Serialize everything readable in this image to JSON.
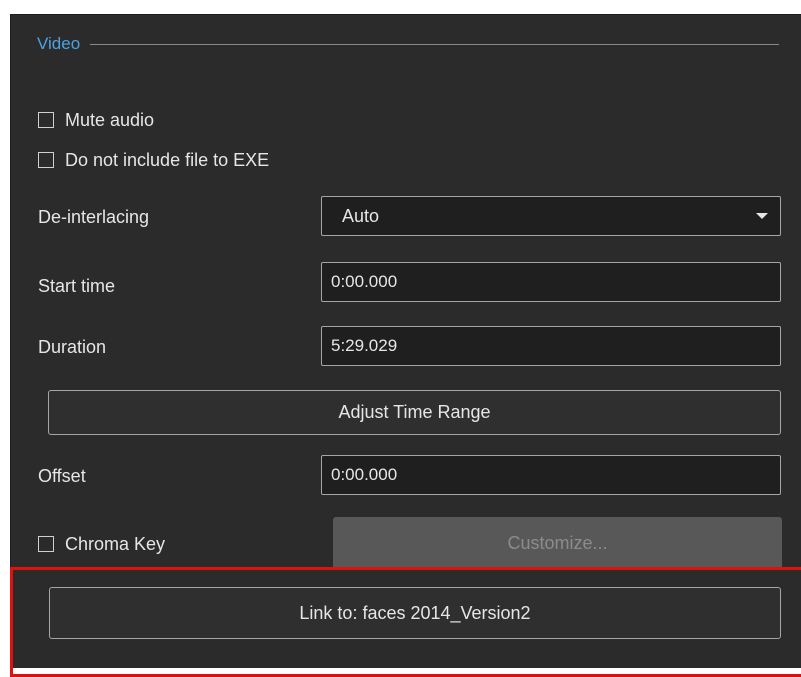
{
  "group": {
    "title": "Video"
  },
  "checkboxes": {
    "mute_audio": {
      "label": "Mute audio",
      "checked": false
    },
    "exclude_from_exe": {
      "label": "Do not include file to EXE",
      "checked": false
    },
    "chroma_key": {
      "label": "Chroma Key",
      "checked": false
    }
  },
  "deinterlacing": {
    "label": "De-interlacing",
    "value": "Auto"
  },
  "start_time": {
    "label": "Start time",
    "value": "0:00.000"
  },
  "duration": {
    "label": "Duration",
    "value": "5:29.029"
  },
  "adjust_button": {
    "label": "Adjust Time Range"
  },
  "offset": {
    "label": "Offset",
    "value": "0:00.000"
  },
  "customize_button": {
    "label": "Customize..."
  },
  "link_button": {
    "label": "Link to: faces 2014_Version2"
  },
  "icons": {
    "dropdown": "chevron-down-icon",
    "checkbox": "checkbox-icon"
  },
  "colors": {
    "panel_bg": "#2b2b2b",
    "accent_title": "#4ba3e3",
    "highlight_border": "#e01010",
    "disabled_bg": "#585858"
  }
}
